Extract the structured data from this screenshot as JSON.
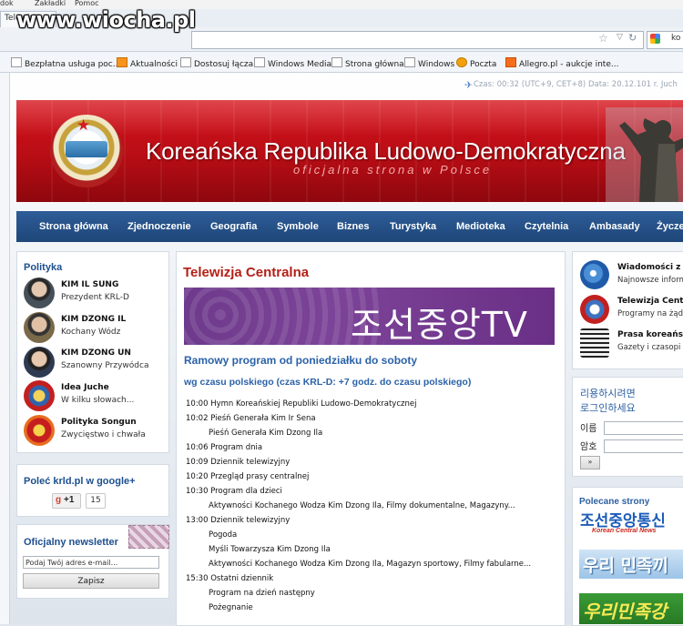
{
  "browser": {
    "menu_items": [
      "dok",
      "Zakładki",
      "Pomoc"
    ],
    "tab_title": "Telewiz",
    "search_fragment": "ko",
    "watermark": "www.wiocha.pl",
    "bookmarks": [
      {
        "label": "Bezpłatna usługa poc...",
        "icon": "page-icon"
      },
      {
        "label": "Aktualności",
        "icon": "rss-icon"
      },
      {
        "label": "Dostosuj łącza",
        "icon": "page-icon"
      },
      {
        "label": "Windows Media",
        "icon": "page-icon"
      },
      {
        "label": "Strona główna",
        "icon": "page-icon"
      },
      {
        "label": "Windows",
        "icon": "page-icon"
      },
      {
        "label": "Poczta",
        "icon": "mail-icon"
      },
      {
        "label": "Allegro.pl - aukcje inte...",
        "icon": "allegro-icon"
      }
    ]
  },
  "clock": "Czas: 00:32 (UTC+9, CET+8) Data: 20.12.101 r. Juch",
  "banner": {
    "title": "Koreańska Republika Ludowo-Demokratyczna",
    "subtitle": "oficjalna strona w Polsce"
  },
  "nav": [
    "Strona główna",
    "Zjednoczenie",
    "Geografia",
    "Symbole",
    "Biznes",
    "Turystyka",
    "Medioteka",
    "Czytelnia",
    "Ambasady",
    "Życze"
  ],
  "politics": {
    "title": "Polityka",
    "items": [
      {
        "name": "KIM IL SUNG",
        "desc": "Prezydent KRL-D"
      },
      {
        "name": "KIM DZONG IL",
        "desc": "Kochany Wódz"
      },
      {
        "name": "KIM DZONG UN",
        "desc": "Szanowny Przywódca"
      },
      {
        "name": "Idea Juche",
        "desc": "W kilku słowach..."
      },
      {
        "name": "Polityka Songun",
        "desc": "Zwycięstwo i chwała"
      }
    ]
  },
  "google": {
    "title": "Poleć krld.pl w google+",
    "plus": "+1",
    "count": "15"
  },
  "newsletter": {
    "title": "Oficjalny newsletter",
    "email_value": "Podaj Twój adres e-mail...",
    "button": "Zapisz"
  },
  "main": {
    "title": "Telewizja Centralna",
    "tv_logo": "조선중앙TV",
    "subhead": "Ramowy program od poniedziałku do soboty",
    "timezone": "wg czasu polskiego (czas KRL-D: +7 godz. do czasu polskiego)",
    "schedule": [
      {
        "time": "10:00",
        "title": "Hymn Koreańskiej Republiki Ludowo-Demokratycznej"
      },
      {
        "time": "10:02",
        "title": "Pieśń Generała Kim Ir Sena"
      },
      {
        "time": "",
        "title": "Pieśń Generała Kim Dzong Ila"
      },
      {
        "time": "10:06",
        "title": "Program dnia"
      },
      {
        "time": "10:09",
        "title": "Dziennik telewizyjny"
      },
      {
        "time": "10:20",
        "title": "Przegląd prasy centralnej"
      },
      {
        "time": "10:30",
        "title": "Program dla dzieci"
      },
      {
        "time": "",
        "title": "Aktywności Kochanego Wodza Kim Dzong Ila, Filmy dokumentalne, Magazyny..."
      },
      {
        "time": "13:00",
        "title": "Dziennik telewizyjny"
      },
      {
        "time": "",
        "title": "Pogoda"
      },
      {
        "time": "",
        "title": "Myśli Towarzysza Kim Dzong Ila"
      },
      {
        "time": "",
        "title": "Aktywności Kochanego Wodza Kim Dzong Ila, Magazyn sportowy, Filmy fabularne..."
      },
      {
        "time": "15:30",
        "title": "Ostatni dziennik"
      },
      {
        "time": "",
        "title": "Program na dzień następny"
      },
      {
        "time": "",
        "title": "Pożegnanie"
      }
    ]
  },
  "right_news": [
    {
      "name": "Wiadomości z K",
      "desc": "Najnowsze inform"
    },
    {
      "name": "Telewizja Centr",
      "desc": "Programy na żąda"
    },
    {
      "name": "Prasa koreańsk",
      "desc": "Gazety i czasopi"
    }
  ],
  "login": {
    "prompt_line1": "리용하시려면",
    "prompt_line2": "로그인하세요",
    "user_label": "이름",
    "pass_label": "암호",
    "button": "»"
  },
  "recommended": {
    "title": "Polecane strony",
    "kcna_kr": "조선중앙통신",
    "kcna_en": "Korean Central News",
    "uri": "우리 민족끼",
    "uri2": "우리민족강"
  }
}
